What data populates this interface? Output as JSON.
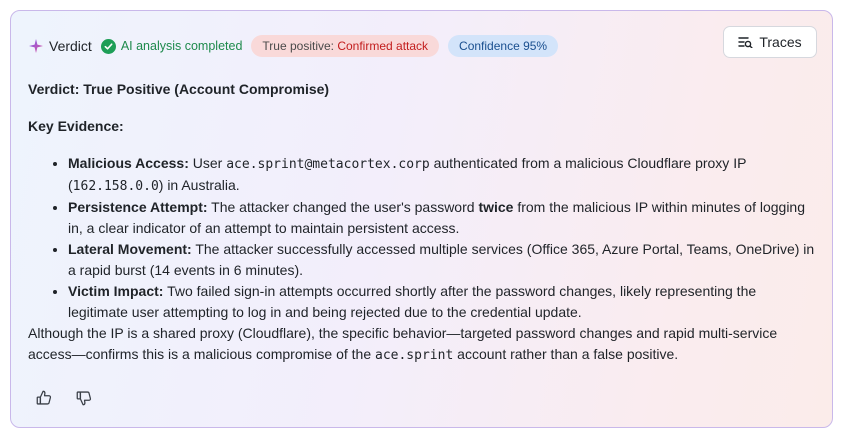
{
  "header": {
    "title": "Verdict",
    "ai_status": "AI analysis completed",
    "tp_prefix": "True positive: ",
    "tp_value": "Confirmed attack",
    "confidence": "Confidence 95%",
    "traces_label": "Traces"
  },
  "content": {
    "heading": "Verdict: True Positive (Account Compromise)",
    "key_evidence": "Key Evidence:",
    "items": [
      {
        "title": "Malicious Access:",
        "t1": " User ",
        "code1": "ace.sprint@metacortex.corp",
        "t2": " authenticated from a malicious Cloudflare proxy IP (",
        "code2": "162.158.0.0",
        "t3": ") in Australia."
      },
      {
        "title": "Persistence Attempt:",
        "t1": " The attacker changed the user's password ",
        "bold": "twice",
        "t2": " from the malicious IP within minutes of logging in, a clear indicator of an attempt to maintain persistent access."
      },
      {
        "title": "Lateral Movement:",
        "t1": " The attacker successfully accessed multiple services (Office 365, Azure Portal, Teams, OneDrive) in a rapid burst (14 events in 6 minutes)."
      },
      {
        "title": "Victim Impact:",
        "t1": " Two failed sign-in attempts occurred shortly after the password changes, likely representing the legitimate user attempting to log in and being rejected due to the credential update."
      }
    ],
    "conclusion_1": "Although the IP is a shared proxy (Cloudflare), the specific behavior—targeted password changes and rapid multi-service access—confirms this is a malicious compromise of the ",
    "conclusion_code": "ace.sprint",
    "conclusion_2": " account rather than a false positive."
  },
  "icons": {
    "sparkle": "sparkle-icon",
    "check": "check-circle-icon",
    "traces": "traces-icon",
    "thumbs_up": "thumbs-up-icon",
    "thumbs_down": "thumbs-down-icon"
  },
  "colors": {
    "success": "#1e9e57",
    "danger": "#c21d1d",
    "info": "#1a4f8f"
  }
}
